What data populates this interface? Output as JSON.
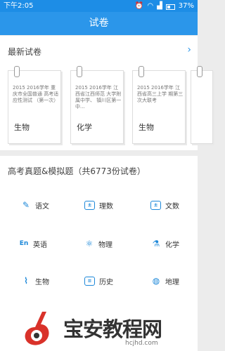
{
  "statusbar": {
    "time": "下午2:05",
    "battery": "37%"
  },
  "title": "试卷",
  "latest": {
    "heading": "最新试卷",
    "papers": [
      {
        "desc": "2015 2016学年 重庆市全国普通 高考适应性测试 （第一次）",
        "subject": "生物"
      },
      {
        "desc": "2015 2016学年 江西省江西师范 大学附属中学、 镇川区第一中...",
        "subject": "化学"
      },
      {
        "desc": "2015 2016学年 江西省高三上学 期第三次大联考",
        "subject": "生物"
      }
    ]
  },
  "section": {
    "heading": "高考真题&模拟题（共6773份试卷）",
    "subjects": [
      {
        "label": "语文",
        "icon": "pen-icon"
      },
      {
        "label": "理数",
        "icon": "calculator-icon"
      },
      {
        "label": "文数",
        "icon": "calculator-icon"
      },
      {
        "label": "英语",
        "icon": "english-icon"
      },
      {
        "label": "物理",
        "icon": "atom-icon"
      },
      {
        "label": "化学",
        "icon": "flask-icon"
      },
      {
        "label": "生物",
        "icon": "dna-icon"
      },
      {
        "label": "历史",
        "icon": "scroll-icon"
      },
      {
        "label": "地理",
        "icon": "globe-icon"
      }
    ]
  },
  "watermark": {
    "name": "宝安教程网",
    "url": "hcjhd.com"
  },
  "colors": {
    "primary": "#2b96ea",
    "statusbar": "#1d8de6",
    "accent_red": "#d9322a"
  }
}
